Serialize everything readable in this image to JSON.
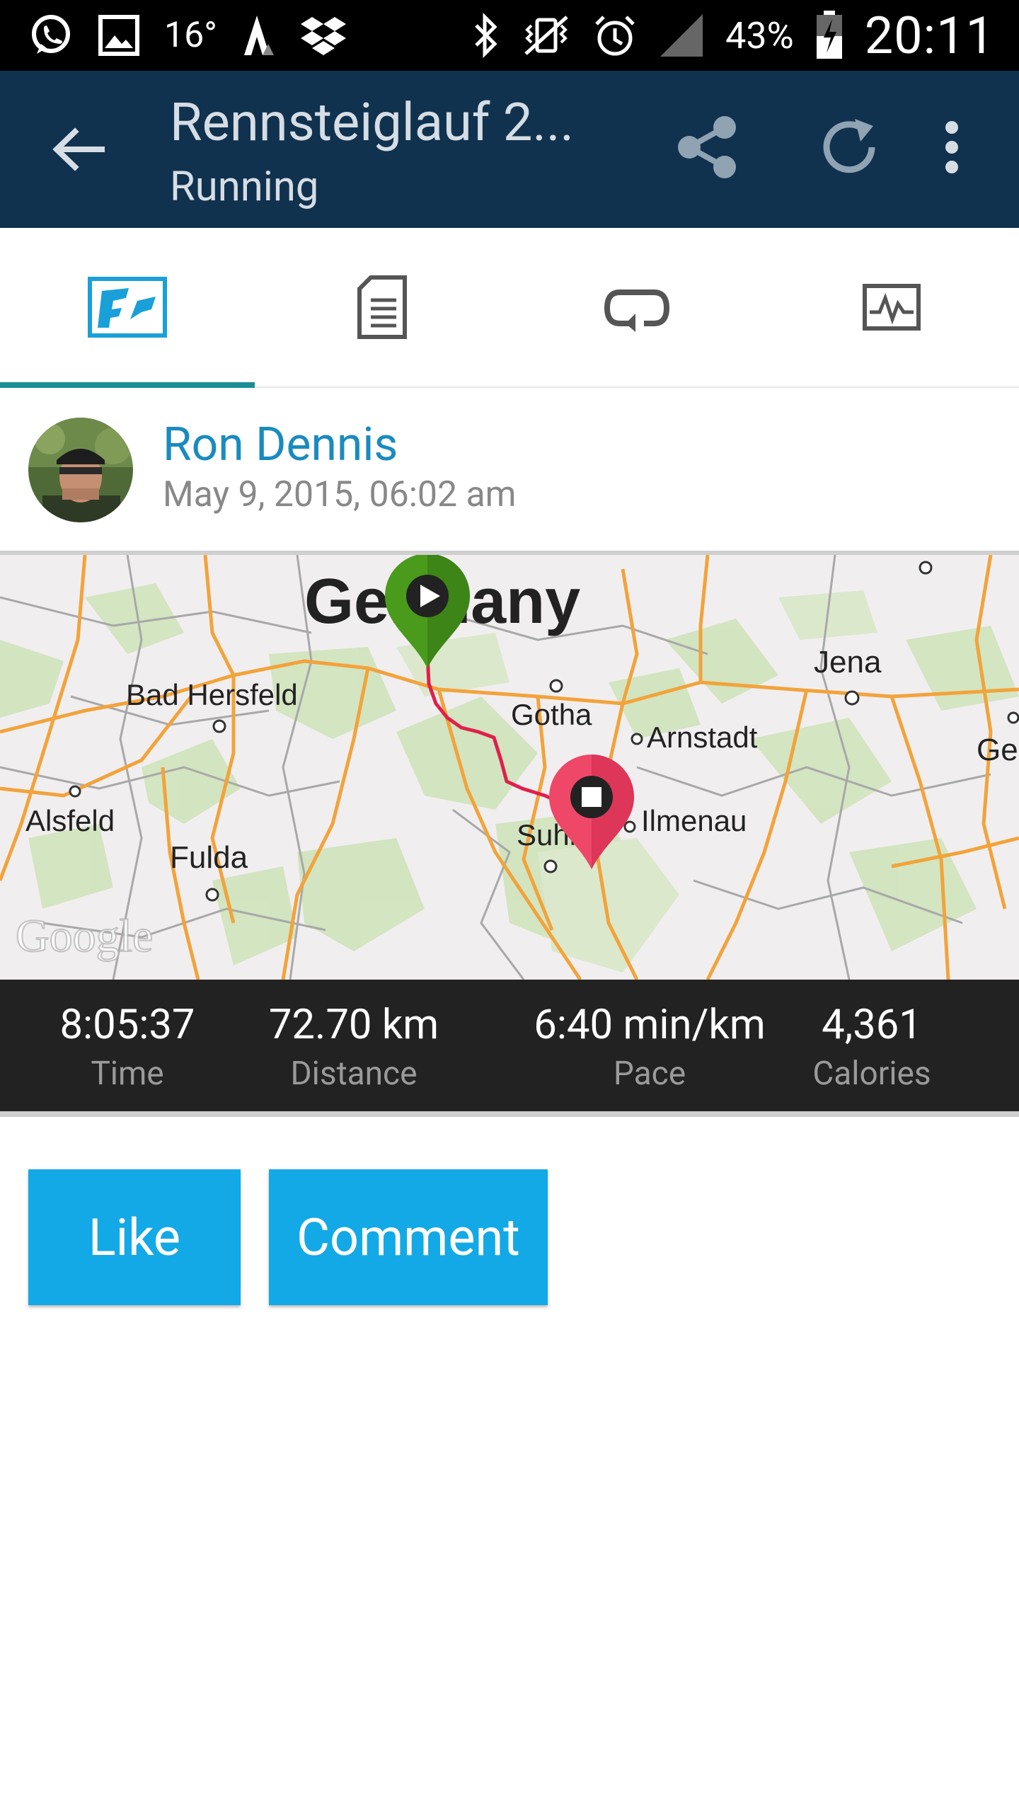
{
  "status_bar": {
    "temperature": "16°",
    "battery": "43%",
    "time": "20:11",
    "icons": [
      "whatsapp-icon",
      "gallery-icon",
      "strava-icon",
      "dropbox-icon",
      "bluetooth-icon",
      "vibrate-icon",
      "alarm-icon",
      "signal-icon",
      "battery-icon"
    ]
  },
  "app_bar": {
    "title": "Rennsteiglauf 2...",
    "subtitle": "Running"
  },
  "tabs": [
    {
      "name": "overview",
      "icon": "map-tab-icon",
      "selected": true
    },
    {
      "name": "details",
      "icon": "document-tab-icon",
      "selected": false
    },
    {
      "name": "laps",
      "icon": "laps-tab-icon",
      "selected": false
    },
    {
      "name": "charts",
      "icon": "chart-tab-icon",
      "selected": false
    }
  ],
  "user": {
    "name": "Ron Dennis",
    "datetime": "May 9, 2015, 06:02 am"
  },
  "map": {
    "places": [
      "Germany",
      "Bad Hersfeld",
      "Gotha",
      "Arnstadt",
      "Jena",
      "Alsfeld",
      "Fulda",
      "Suhl",
      "Ilmenau",
      "Ge"
    ],
    "watermark": "Google",
    "start_marker": "start-marker",
    "end_marker": "finish-marker"
  },
  "stats": [
    {
      "value": "8:05:37",
      "label": "Time"
    },
    {
      "value": "72.70 km",
      "label": "Distance"
    },
    {
      "value": "6:40 min/km",
      "label": "Pace"
    },
    {
      "value": "4,361",
      "label": "Calories"
    }
  ],
  "actions": {
    "like": "Like",
    "comment": "Comment"
  },
  "colors": {
    "app_bar": "#10324f",
    "accent": "#1a8e94",
    "button": "#12a9e6",
    "route": "#e0204a",
    "start_pin": "#4a9a1c",
    "end_pin": "#ef4768"
  }
}
